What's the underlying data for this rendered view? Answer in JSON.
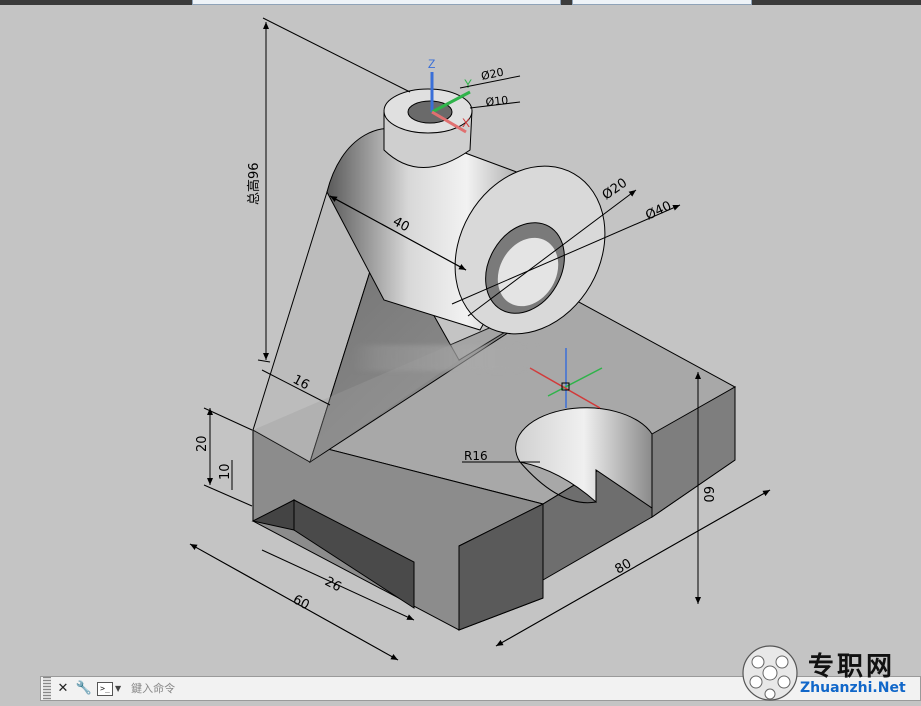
{
  "command_line": {
    "close_icon": "close-icon",
    "settings_icon": "wrench-icon",
    "prompt_icon": "command-prompt-icon",
    "prompt_glyph": ">_",
    "placeholder": "鍵入命令"
  },
  "dimensions": {
    "total_height": "总高96",
    "top_boss_outer": "Ø20",
    "top_boss_inner": "Ø10",
    "cylinder_length": "40",
    "bore_dia": "Ø20",
    "cylinder_dia": "Ø40",
    "rib_thickness": "16",
    "base_height": "20",
    "base_foot": "10",
    "slot_radius": "R16",
    "base_width_inner": "26",
    "base_width": "60",
    "base_length": "80",
    "base_depth": "60"
  },
  "ucs": {
    "z": "Z",
    "y": "Y",
    "x": "X"
  },
  "watermark": {
    "cn": "专职网",
    "en": "Zhuanzhi.Net"
  },
  "colors": {
    "background": "#c4c4c4",
    "ucs_x": "#d23a3a",
    "ucs_y": "#2fb34a",
    "ucs_z": "#3a6fd8",
    "watermark_blue": "#1167c9"
  }
}
